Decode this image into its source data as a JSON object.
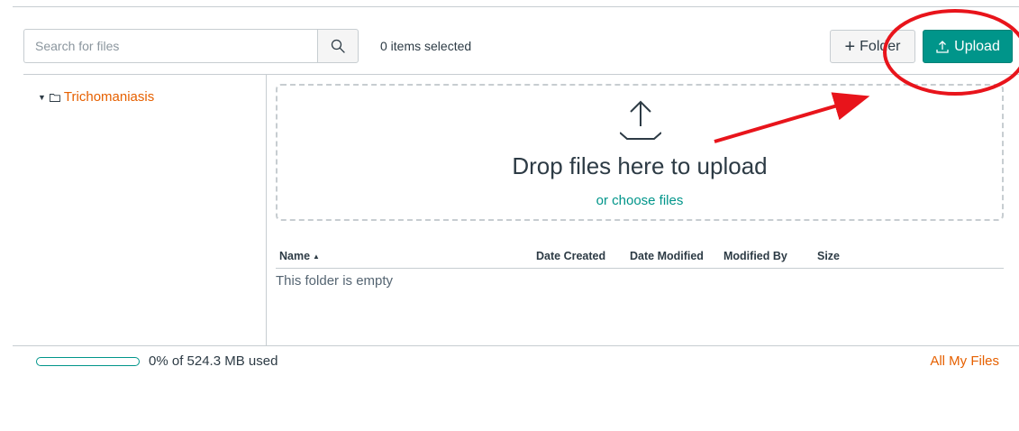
{
  "toolbar": {
    "search_placeholder": "Search for files",
    "search_icon": "search-icon",
    "selected_count": "0 items selected",
    "folder_label": "Folder",
    "folder_icon": "plus-icon",
    "upload_label": "Upload",
    "upload_icon": "upload-icon"
  },
  "tree": {
    "items": [
      {
        "label": "Trichomaniasis",
        "expanded": true,
        "icon": "folder-icon"
      }
    ]
  },
  "dropzone": {
    "icon": "upload-icon",
    "title": "Drop files here to upload",
    "choose_label": "or choose files"
  },
  "table": {
    "columns": {
      "name": "Name",
      "date_created": "Date Created",
      "date_modified": "Date Modified",
      "modified_by": "Modified By",
      "size": "Size"
    },
    "sort": {
      "column": "name",
      "direction": "ascending"
    },
    "empty_message": "This folder is empty"
  },
  "footer": {
    "quota_used_fraction": 0,
    "quota_text": "0% of 524.3 MB used",
    "all_files_label": "All My Files"
  },
  "colors": {
    "accent": "#00958a",
    "link": "#e66000",
    "annotation": "#e8141b"
  }
}
